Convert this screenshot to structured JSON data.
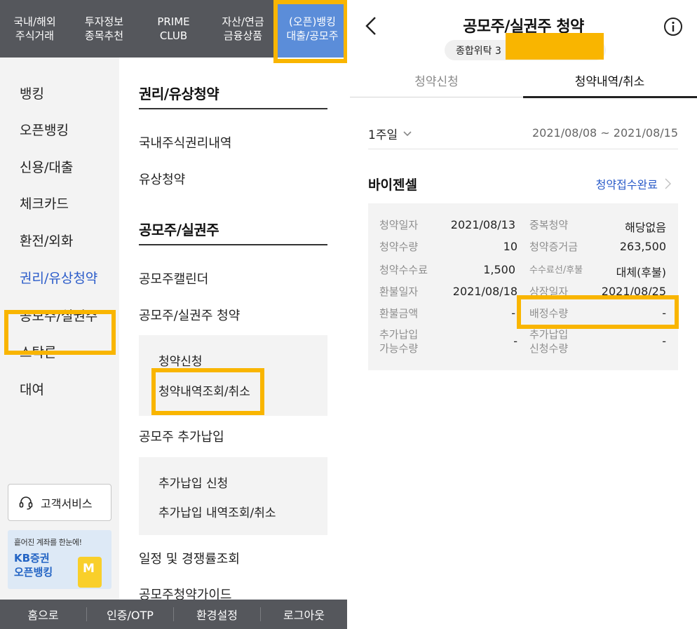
{
  "left_panel": {
    "top_nav": [
      {
        "label": "국내/해외\n주식거래"
      },
      {
        "label": "투자정보\n종목추천"
      },
      {
        "label": "PRIME\nCLUB"
      },
      {
        "label": "자산/연금\n금융상품"
      },
      {
        "label": "(오픈)뱅킹\n대출/공모주"
      }
    ],
    "sidebar": [
      "뱅킹",
      "오픈뱅킹",
      "신용/대출",
      "체크카드",
      "환전/외화",
      "권리/유상청약",
      "공모주/실권주",
      "스탁론",
      "대여"
    ],
    "customer_service_label": "고객서비스",
    "banner": {
      "subtitle": "흩어진 계좌를 한눈에!",
      "title": "KB증권\n오픈뱅킹",
      "card_letter": "M"
    },
    "content": {
      "section1_title": "권리/유상청약",
      "section1_items": [
        "국내주식권리내역",
        "유상청약"
      ],
      "section2_title": "공모주/실권주",
      "section2_items": [
        "공모주캘린더",
        "공모주/실권주 청약"
      ],
      "subscription_sub": [
        "청약신청",
        "청약내역조회/취소"
      ],
      "additional_title": "공모주 추가납입",
      "additional_sub": [
        "추가납입 신청",
        "추가납입 내역조회/취소"
      ],
      "more_items": [
        "일정 및 경쟁률조회",
        "공모주청약가이드"
      ]
    },
    "bottom_bar": [
      "홈으로",
      "인증/OTP",
      "환경설정",
      "로그아웃"
    ]
  },
  "right_panel": {
    "title": "공모주/실권주 청약",
    "account_prefix": "종합위탁 3",
    "tabs": [
      "청약신청",
      "청약내역/취소"
    ],
    "period": "1주일",
    "date_range": "2021/08/08 ~ 2021/08/15",
    "stock_name": "바이젠셀",
    "status": "청약접수완료",
    "details_left": [
      {
        "label": "청약일자",
        "value": "2021/08/13"
      },
      {
        "label": "청약수량",
        "value": "10"
      },
      {
        "label": "청약수수료",
        "value": "1,500"
      },
      {
        "label": "환불일자",
        "value": "2021/08/18"
      },
      {
        "label": "환불금액",
        "value": "-"
      },
      {
        "label": "추가납입\n가능수량",
        "value": "-"
      }
    ],
    "details_right": [
      {
        "label": "중복청약",
        "value": "해당없음"
      },
      {
        "label": "청약증거금",
        "value": "263,500"
      },
      {
        "label": "수수료선/후불",
        "value": "대체(후불)"
      },
      {
        "label": "상장일자",
        "value": "2021/08/25"
      },
      {
        "label": "배정수량",
        "value": "-"
      },
      {
        "label": "추가납입\n신청수량",
        "value": "-"
      }
    ]
  },
  "colors": {
    "highlight": "#f9b500",
    "accent_blue": "#2a5bc9",
    "nav_dark": "#55575c",
    "nav_active": "#5b8dd9"
  }
}
